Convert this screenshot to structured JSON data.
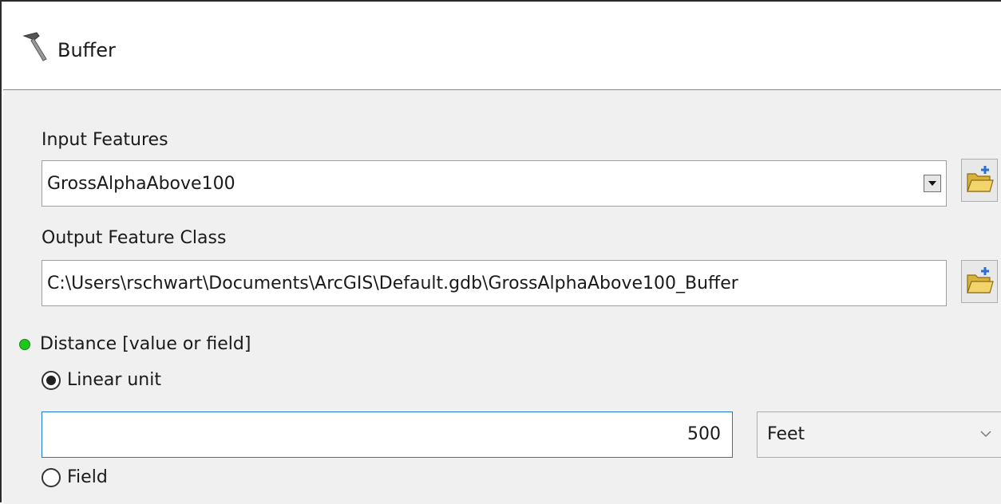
{
  "window": {
    "title": "Buffer",
    "icon": "hammer-icon"
  },
  "input_features": {
    "label": "Input Features",
    "value": "GrossAlphaAbove100",
    "dropdown_icon": "dropdown-arrow-icon",
    "browse_icon": "open-folder-icon"
  },
  "output_feature_class": {
    "label": "Output Feature Class",
    "value": "C:\\Users\\rschwart\\Documents\\ArcGIS\\Default.gdb\\GrossAlphaAbove100_Buffer",
    "browse_icon": "open-folder-icon"
  },
  "distance": {
    "label": "Distance [value or field]",
    "required_indicator": "green-dot",
    "linear_unit": {
      "label": "Linear unit",
      "selected": true
    },
    "value": "500",
    "unit": "Feet",
    "field": {
      "label": "Field",
      "selected": false
    }
  },
  "colors": {
    "panel_bg": "#f0f0f0",
    "focus_border": "#1e78d0",
    "required_dot": "#1ec61e"
  }
}
